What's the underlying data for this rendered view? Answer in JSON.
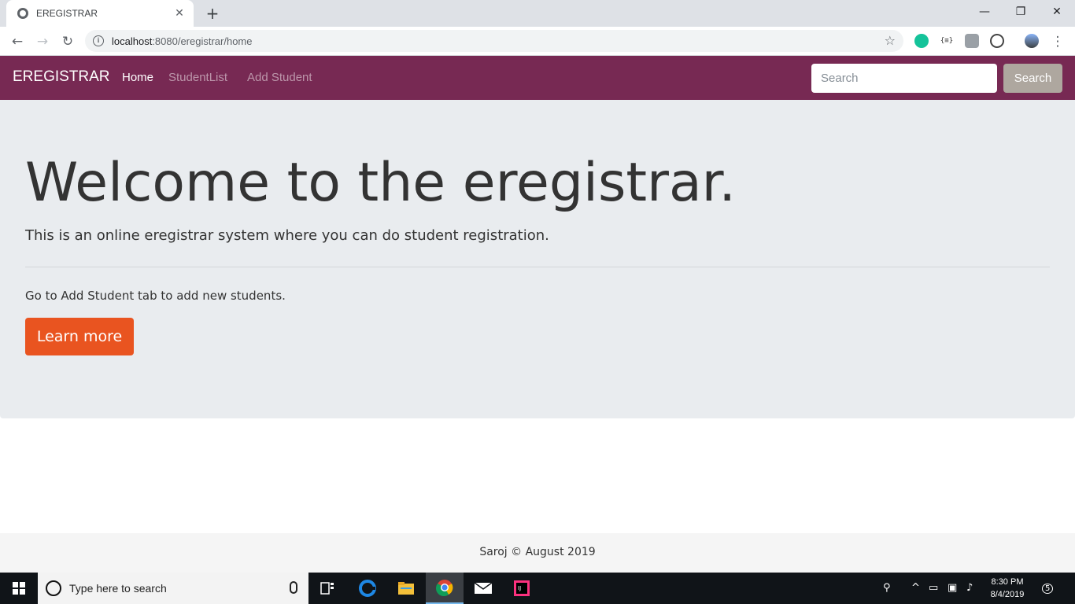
{
  "browser": {
    "tab_title": "EREGISTRAR",
    "tab_close": "✕",
    "new_tab": "+",
    "url_host": "localhost",
    "url_rest": ":8080/eregistrar/home",
    "window_controls": {
      "minimize": "—",
      "restore": "❐",
      "close": "✕"
    }
  },
  "navbar": {
    "brand": "EREGISTRAR",
    "links": [
      {
        "label": "Home",
        "active": true
      },
      {
        "label": "StudentList",
        "active": false
      },
      {
        "label": "Add Student",
        "active": false
      }
    ],
    "search_placeholder": "Search",
    "search_button": "Search",
    "colors": {
      "background": "#772953",
      "button": "#aea79f"
    }
  },
  "jumbotron": {
    "heading": "Welcome to the eregistrar.",
    "lead": "This is an online eregistrar system where you can do student registration.",
    "hint": "Go to Add Student tab to add new students.",
    "button": "Learn more",
    "colors": {
      "background": "#e9ecef",
      "button": "#e95420"
    }
  },
  "footer": {
    "text": "Saroj © August 2019"
  },
  "taskbar": {
    "search_placeholder": "Type here to search",
    "time": "8:30 PM",
    "date": "8/4/2019",
    "notification_count": "5",
    "apps": [
      "task-view-icon",
      "edge-icon",
      "file-explorer-icon",
      "chrome-icon",
      "mail-icon",
      "intellij-icon"
    ]
  }
}
